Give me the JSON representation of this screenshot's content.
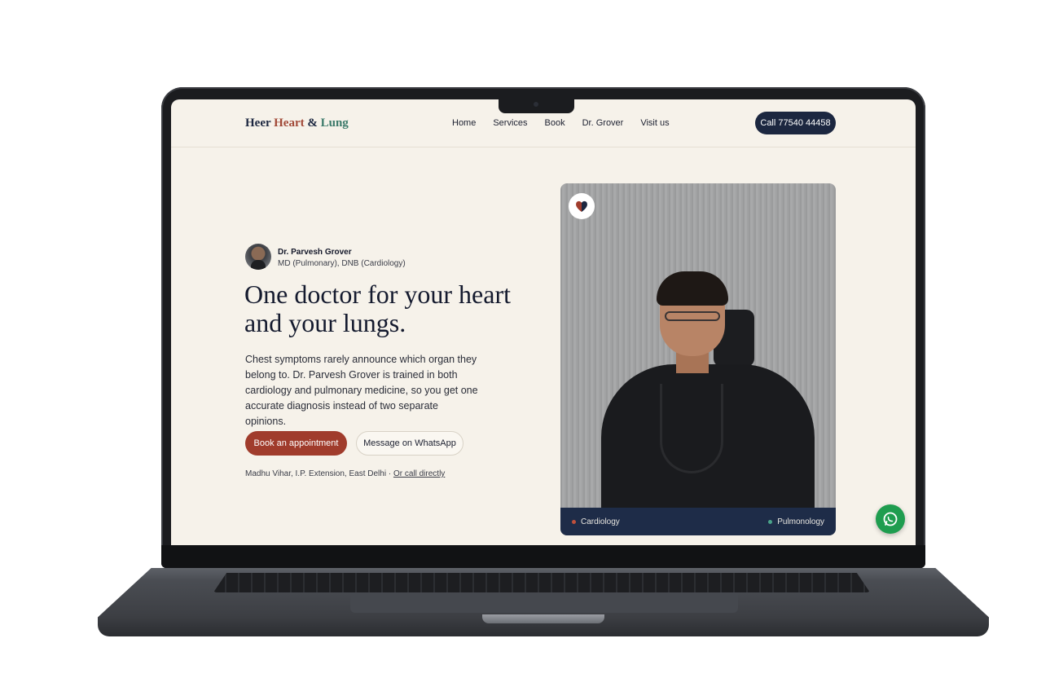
{
  "header": {
    "brand": {
      "word1": "Heer",
      "word2": "Heart",
      "amp": "&",
      "word3": "Lung"
    },
    "nav": [
      "Home",
      "Services",
      "Book",
      "Dr. Grover",
      "Visit us"
    ],
    "call_button": "Call 77540 44458"
  },
  "hero": {
    "doctor_name": "Dr. Parvesh Grover",
    "doctor_credentials": "MD (Pulmonary), DNB (Cardiology)",
    "headline": "One doctor for your heart and your lungs.",
    "lead": "Chest symptoms rarely announce which organ they belong to. Dr. Parvesh Grover is trained in both cardiology and pulmonary medicine, so you get one accurate diagnosis instead of two separate opinions.",
    "primary_cta": "Book an appointment",
    "secondary_cta": "Message on WhatsApp",
    "address": "Madhu Vihar, I.P. Extension, East Delhi · ",
    "call_link": "Or call directly"
  },
  "photo_card": {
    "tags": [
      {
        "label": "Cardiology",
        "color": "#c0503c"
      },
      {
        "label": "Pulmonology",
        "color": "#4aa38a"
      }
    ]
  },
  "colors": {
    "navy": "#1c2740",
    "brick": "#a03c2c",
    "teal": "#3c7a6a",
    "whatsapp": "#1f9d4f",
    "background": "#f6f2ea"
  },
  "icons": {
    "logo_badge": "heart-lung-logo-icon",
    "floating_chat": "whatsapp-icon"
  }
}
